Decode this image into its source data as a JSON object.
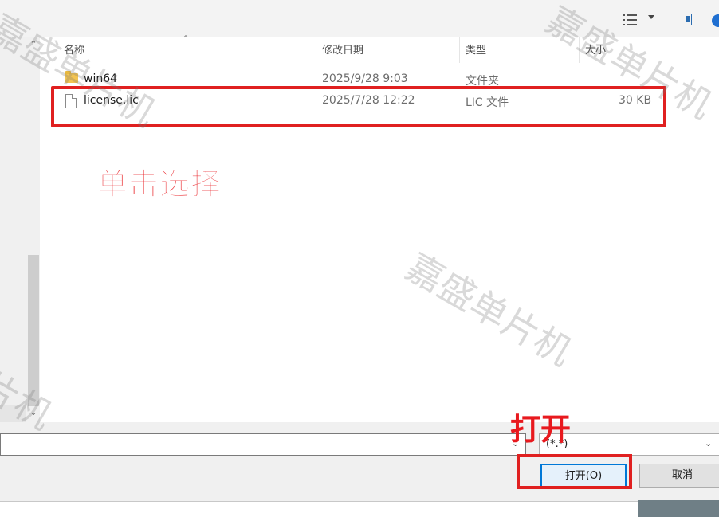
{
  "toolbar": {
    "view_icon": "details-view-icon",
    "view_dropdown_icon": "chevron-down-icon",
    "preview_icon": "preview-pane-icon",
    "help_icon": "help-icon"
  },
  "columns": {
    "name": "名称",
    "date": "修改日期",
    "type": "类型",
    "size": "大小"
  },
  "rows": [
    {
      "name": "win64",
      "date": "2025/9/28 9:03",
      "type": "文件夹",
      "size": "",
      "icon": "folder-icon"
    },
    {
      "name": "license.lic",
      "date": "2025/7/28 12:22",
      "type": "LIC 文件",
      "size": "30 KB",
      "icon": "file-icon"
    }
  ],
  "annotations": {
    "select_hint": "单击选择",
    "open_hint": "打开"
  },
  "footer": {
    "filename_value": "",
    "filter_value": "(*.*)",
    "open_label": "打开(O)",
    "cancel_label": "取消"
  },
  "watermark": "嘉盛单片机",
  "colors": {
    "annotation_red": "#e8191e",
    "accent_blue": "#0078d7"
  }
}
